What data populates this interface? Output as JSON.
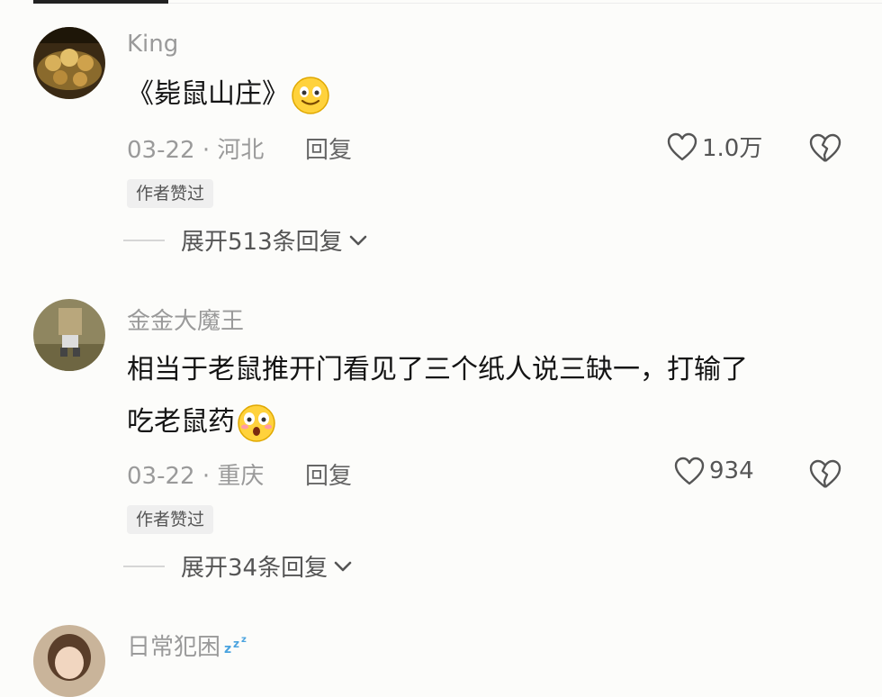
{
  "comments": [
    {
      "username": "King",
      "content_lines": [
        "《毙鼠山庄》"
      ],
      "emoji": "smiling-face",
      "date": "03-22",
      "location": "河北",
      "reply_label": "回复",
      "likes": "1.0万",
      "badge": "作者赞过",
      "expand_text": "展开513条回复"
    },
    {
      "username": "金金大魔王",
      "content_lines": [
        "相当于老鼠推开门看见了三个纸人说三缺一，打输了",
        "吃老鼠药"
      ],
      "emoji": "astonished-face",
      "date": "03-22",
      "location": "重庆",
      "reply_label": "回复",
      "likes": "934",
      "badge": "作者赞过",
      "expand_text": "展开34条回复"
    },
    {
      "username": "日常犯困",
      "username_emoji": "zzz"
    }
  ],
  "separator": "·",
  "colors": {
    "meta": "#9a9a9a",
    "text": "#141414",
    "badge_bg": "#efefef"
  }
}
